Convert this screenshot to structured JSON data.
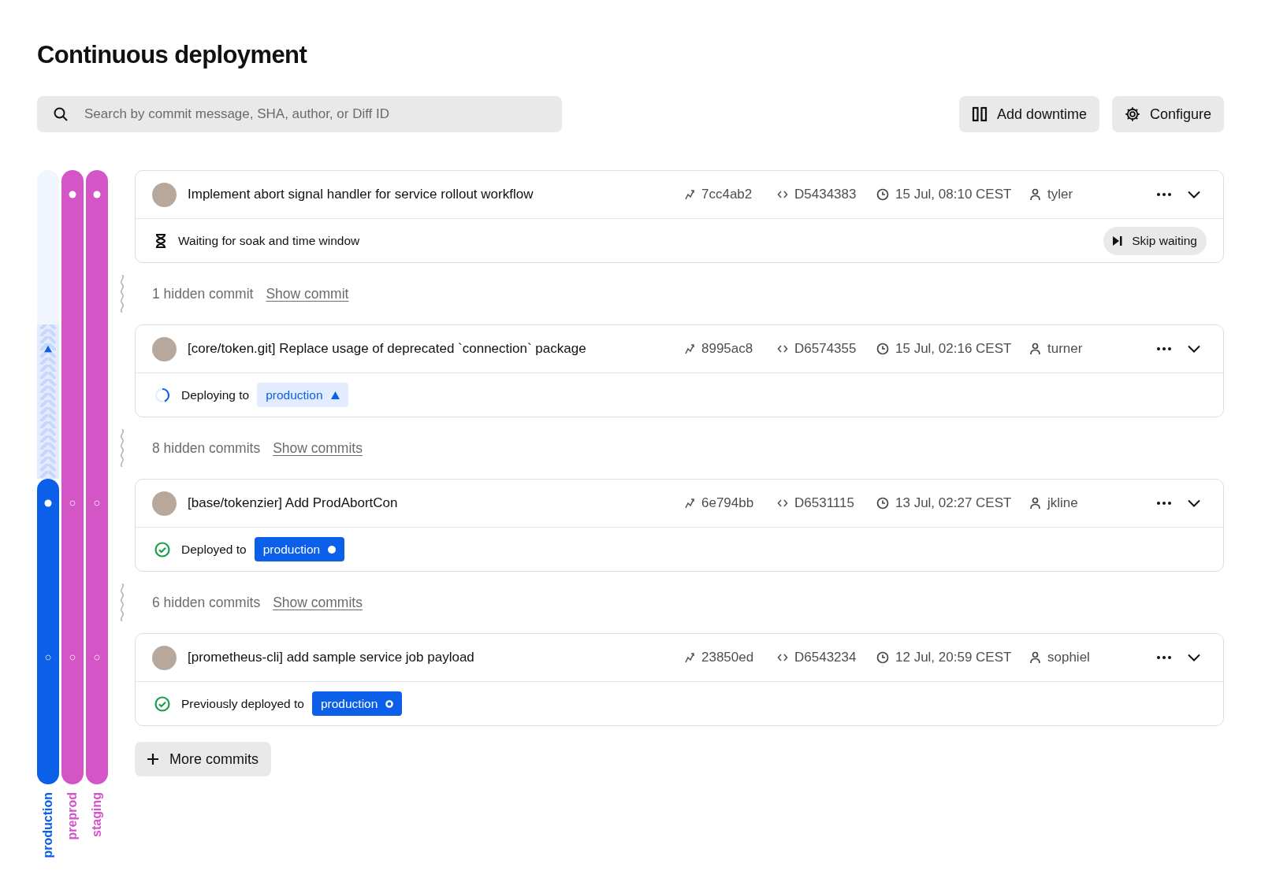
{
  "title": "Continuous deployment",
  "search": {
    "placeholder": "Search by commit message, SHA, author, or Diff ID"
  },
  "toolbar": [
    {
      "kind": "downtime",
      "label": "Add downtime"
    },
    {
      "kind": "configure",
      "label": "Configure"
    }
  ],
  "lanes": [
    {
      "label": "production",
      "color": "#0b5fe8",
      "segments": [
        {
          "kind": "pending"
        },
        {
          "kind": "deploying",
          "marker": {
            "kind": "arrow"
          }
        },
        {
          "kind": "deployed",
          "marker": {
            "kind": "filled"
          }
        },
        {
          "kind": "deployed",
          "marker": {
            "kind": "hollow"
          }
        }
      ]
    },
    {
      "label": "preprod",
      "color": "#d455c6",
      "segments": [
        {
          "kind": "deployed",
          "marker": {
            "kind": "filled"
          }
        },
        {
          "kind": "deployed"
        },
        {
          "kind": "deployed",
          "marker": {
            "kind": "hollow"
          }
        },
        {
          "kind": "deployed",
          "marker": {
            "kind": "hollow"
          }
        }
      ]
    },
    {
      "label": "staging",
      "color": "#d455c6",
      "segments": [
        {
          "kind": "deployed",
          "marker": {
            "kind": "filled"
          }
        },
        {
          "kind": "deployed"
        },
        {
          "kind": "deployed",
          "marker": {
            "kind": "hollow"
          }
        },
        {
          "kind": "deployed",
          "marker": {
            "kind": "hollow"
          }
        }
      ]
    }
  ],
  "commits": [
    {
      "message": "Implement abort signal handler for service rollout workflow",
      "sha": "7cc4ab2",
      "diff": "D5434383",
      "time": "15 Jul, 08:10 CEST",
      "author": "tyler",
      "status": {
        "kind": "waiting",
        "text": "Waiting for soak and time window"
      },
      "action": "Skip waiting",
      "hidden": {
        "text": "1 hidden commit",
        "link": "Show commit"
      }
    },
    {
      "message": "[core/token.git] Replace usage of deprecated `connection` package",
      "sha": "8995ac8",
      "diff": "D6574355",
      "time": "15 Jul, 02:16 CEST",
      "author": "turner",
      "status": {
        "kind": "deploying",
        "text": "Deploying to",
        "badge": {
          "label": "production",
          "kind": "light",
          "marker": {
            "kind": "arrow"
          }
        }
      },
      "hidden": {
        "text": "8 hidden commits",
        "link": "Show commits"
      }
    },
    {
      "message": "[base/tokenzier] Add ProdAbortCon",
      "sha": "6e794bb",
      "diff": "D6531115",
      "time": "13 Jul, 02:27 CEST",
      "author": "jkline",
      "status": {
        "kind": "deployed",
        "text": "Deployed to",
        "badge": {
          "label": "production",
          "kind": "solid",
          "marker": {
            "kind": "filled"
          }
        }
      },
      "hidden": {
        "text": "6 hidden commits",
        "link": "Show commits"
      }
    },
    {
      "message": "[prometheus-cli] add sample service job payload",
      "sha": "23850ed",
      "diff": "D6543234",
      "time": "12 Jul, 20:59 CEST",
      "author": "sophiel",
      "status": {
        "kind": "deployed",
        "text": "Previously deployed to",
        "badge": {
          "label": "production",
          "kind": "solid",
          "marker": {
            "kind": "hollow"
          }
        }
      }
    }
  ],
  "more_button": "More commits"
}
